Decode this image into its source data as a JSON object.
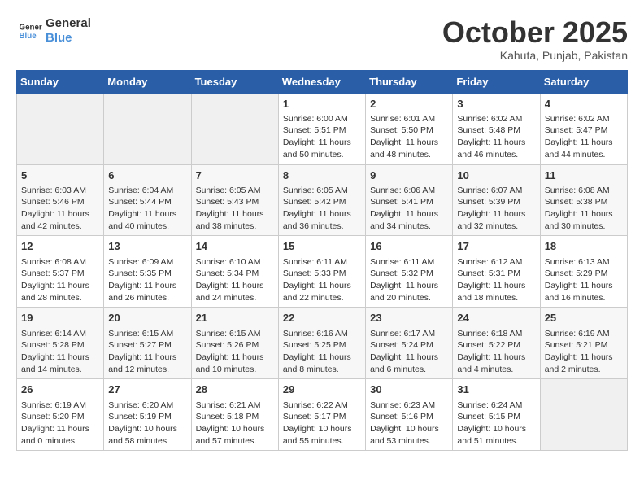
{
  "header": {
    "logo_line1": "General",
    "logo_line2": "Blue",
    "month": "October 2025",
    "location": "Kahuta, Punjab, Pakistan"
  },
  "weekdays": [
    "Sunday",
    "Monday",
    "Tuesday",
    "Wednesday",
    "Thursday",
    "Friday",
    "Saturday"
  ],
  "weeks": [
    [
      {
        "day": "",
        "info": ""
      },
      {
        "day": "",
        "info": ""
      },
      {
        "day": "",
        "info": ""
      },
      {
        "day": "1",
        "info": "Sunrise: 6:00 AM\nSunset: 5:51 PM\nDaylight: 11 hours\nand 50 minutes."
      },
      {
        "day": "2",
        "info": "Sunrise: 6:01 AM\nSunset: 5:50 PM\nDaylight: 11 hours\nand 48 minutes."
      },
      {
        "day": "3",
        "info": "Sunrise: 6:02 AM\nSunset: 5:48 PM\nDaylight: 11 hours\nand 46 minutes."
      },
      {
        "day": "4",
        "info": "Sunrise: 6:02 AM\nSunset: 5:47 PM\nDaylight: 11 hours\nand 44 minutes."
      }
    ],
    [
      {
        "day": "5",
        "info": "Sunrise: 6:03 AM\nSunset: 5:46 PM\nDaylight: 11 hours\nand 42 minutes."
      },
      {
        "day": "6",
        "info": "Sunrise: 6:04 AM\nSunset: 5:44 PM\nDaylight: 11 hours\nand 40 minutes."
      },
      {
        "day": "7",
        "info": "Sunrise: 6:05 AM\nSunset: 5:43 PM\nDaylight: 11 hours\nand 38 minutes."
      },
      {
        "day": "8",
        "info": "Sunrise: 6:05 AM\nSunset: 5:42 PM\nDaylight: 11 hours\nand 36 minutes."
      },
      {
        "day": "9",
        "info": "Sunrise: 6:06 AM\nSunset: 5:41 PM\nDaylight: 11 hours\nand 34 minutes."
      },
      {
        "day": "10",
        "info": "Sunrise: 6:07 AM\nSunset: 5:39 PM\nDaylight: 11 hours\nand 32 minutes."
      },
      {
        "day": "11",
        "info": "Sunrise: 6:08 AM\nSunset: 5:38 PM\nDaylight: 11 hours\nand 30 minutes."
      }
    ],
    [
      {
        "day": "12",
        "info": "Sunrise: 6:08 AM\nSunset: 5:37 PM\nDaylight: 11 hours\nand 28 minutes."
      },
      {
        "day": "13",
        "info": "Sunrise: 6:09 AM\nSunset: 5:35 PM\nDaylight: 11 hours\nand 26 minutes."
      },
      {
        "day": "14",
        "info": "Sunrise: 6:10 AM\nSunset: 5:34 PM\nDaylight: 11 hours\nand 24 minutes."
      },
      {
        "day": "15",
        "info": "Sunrise: 6:11 AM\nSunset: 5:33 PM\nDaylight: 11 hours\nand 22 minutes."
      },
      {
        "day": "16",
        "info": "Sunrise: 6:11 AM\nSunset: 5:32 PM\nDaylight: 11 hours\nand 20 minutes."
      },
      {
        "day": "17",
        "info": "Sunrise: 6:12 AM\nSunset: 5:31 PM\nDaylight: 11 hours\nand 18 minutes."
      },
      {
        "day": "18",
        "info": "Sunrise: 6:13 AM\nSunset: 5:29 PM\nDaylight: 11 hours\nand 16 minutes."
      }
    ],
    [
      {
        "day": "19",
        "info": "Sunrise: 6:14 AM\nSunset: 5:28 PM\nDaylight: 11 hours\nand 14 minutes."
      },
      {
        "day": "20",
        "info": "Sunrise: 6:15 AM\nSunset: 5:27 PM\nDaylight: 11 hours\nand 12 minutes."
      },
      {
        "day": "21",
        "info": "Sunrise: 6:15 AM\nSunset: 5:26 PM\nDaylight: 11 hours\nand 10 minutes."
      },
      {
        "day": "22",
        "info": "Sunrise: 6:16 AM\nSunset: 5:25 PM\nDaylight: 11 hours\nand 8 minutes."
      },
      {
        "day": "23",
        "info": "Sunrise: 6:17 AM\nSunset: 5:24 PM\nDaylight: 11 hours\nand 6 minutes."
      },
      {
        "day": "24",
        "info": "Sunrise: 6:18 AM\nSunset: 5:22 PM\nDaylight: 11 hours\nand 4 minutes."
      },
      {
        "day": "25",
        "info": "Sunrise: 6:19 AM\nSunset: 5:21 PM\nDaylight: 11 hours\nand 2 minutes."
      }
    ],
    [
      {
        "day": "26",
        "info": "Sunrise: 6:19 AM\nSunset: 5:20 PM\nDaylight: 11 hours\nand 0 minutes."
      },
      {
        "day": "27",
        "info": "Sunrise: 6:20 AM\nSunset: 5:19 PM\nDaylight: 10 hours\nand 58 minutes."
      },
      {
        "day": "28",
        "info": "Sunrise: 6:21 AM\nSunset: 5:18 PM\nDaylight: 10 hours\nand 57 minutes."
      },
      {
        "day": "29",
        "info": "Sunrise: 6:22 AM\nSunset: 5:17 PM\nDaylight: 10 hours\nand 55 minutes."
      },
      {
        "day": "30",
        "info": "Sunrise: 6:23 AM\nSunset: 5:16 PM\nDaylight: 10 hours\nand 53 minutes."
      },
      {
        "day": "31",
        "info": "Sunrise: 6:24 AM\nSunset: 5:15 PM\nDaylight: 10 hours\nand 51 minutes."
      },
      {
        "day": "",
        "info": ""
      }
    ]
  ]
}
